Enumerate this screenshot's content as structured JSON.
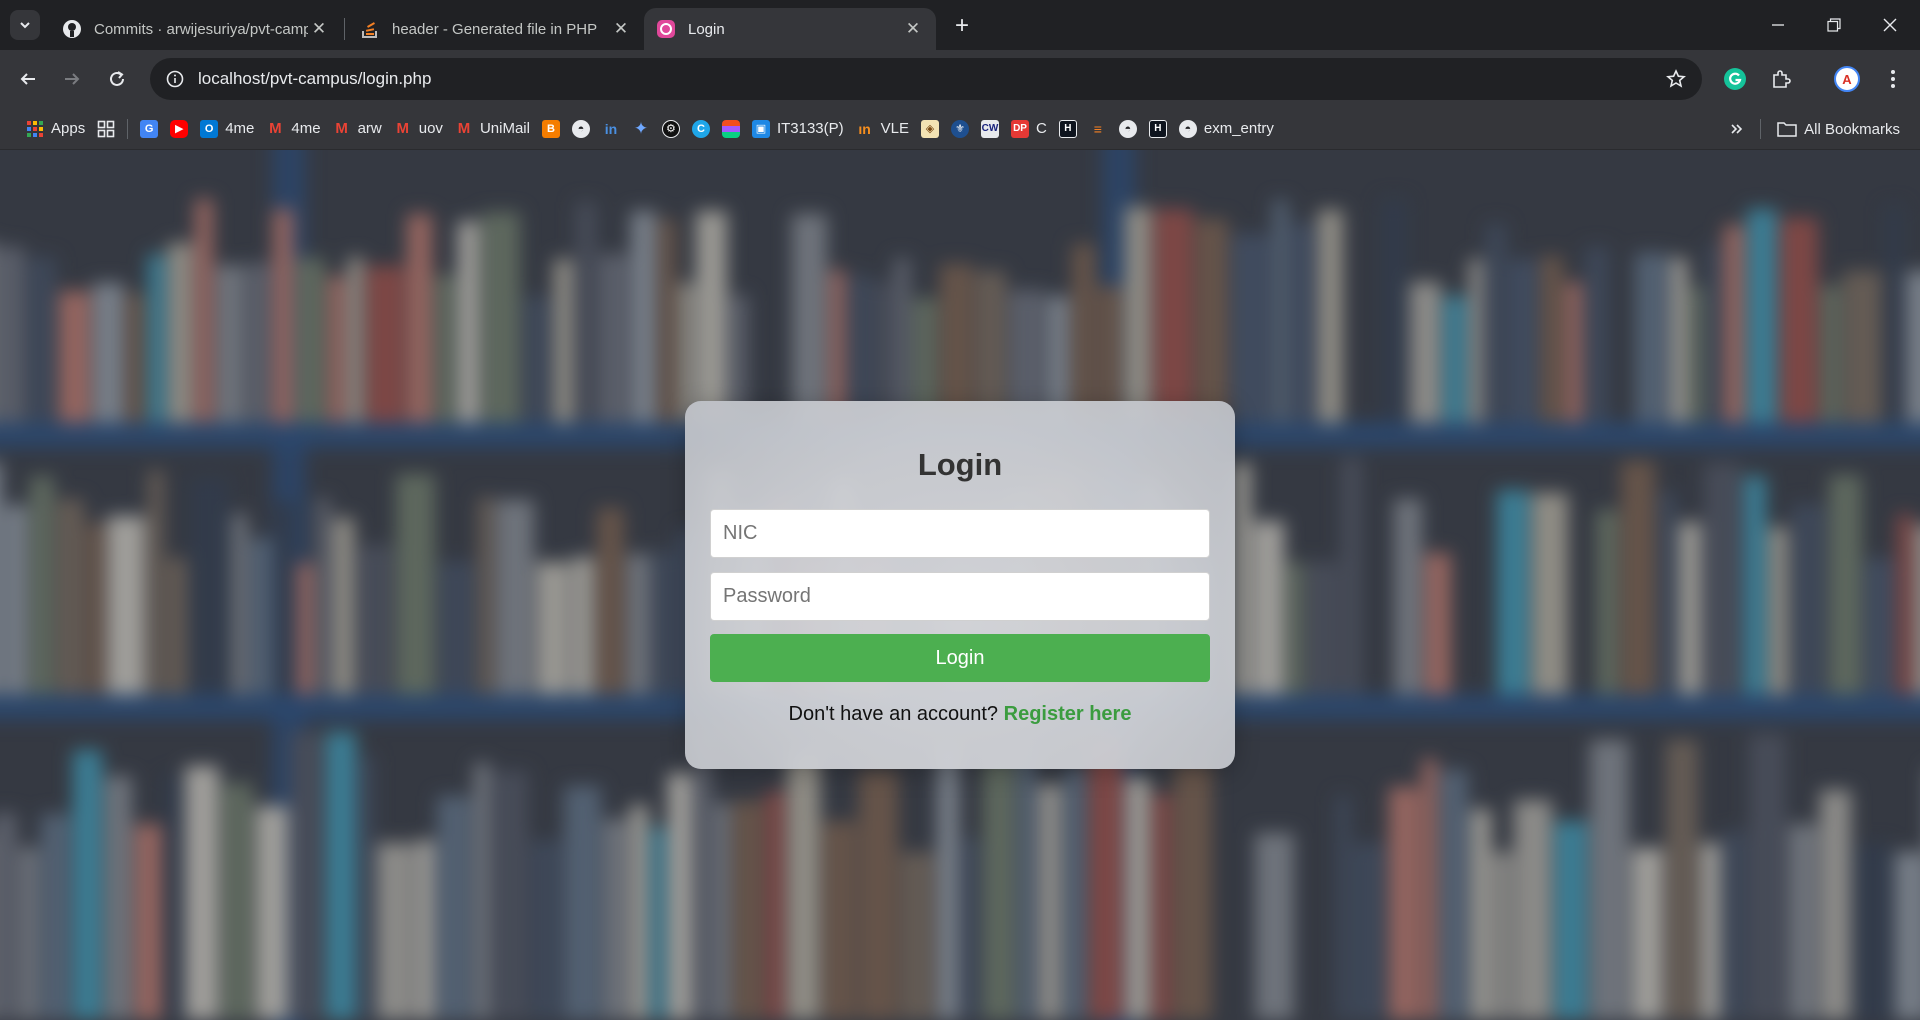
{
  "browser": {
    "tabs": [
      {
        "title": "Commits · arwijesuriya/pvt-campus",
        "icon": "github-icon"
      },
      {
        "title": "header - Generated file in PHP",
        "icon": "stackoverflow-icon"
      },
      {
        "title": "Login",
        "icon": "pink-app-icon",
        "active": true
      }
    ],
    "address_bar": {
      "url": "localhost/pvt-campus/login.php"
    },
    "bookmarks": [
      {
        "label": "Apps",
        "icon": "apps-grid-icon"
      },
      {
        "label": "",
        "icon": "grid-icon"
      },
      {
        "label": "",
        "icon": "google-translate-icon"
      },
      {
        "label": "",
        "icon": "youtube-icon"
      },
      {
        "label": "4me",
        "icon": "outlook-icon"
      },
      {
        "label": "4me",
        "icon": "gmail-icon"
      },
      {
        "label": "arw",
        "icon": "gmail-icon"
      },
      {
        "label": "uov",
        "icon": "gmail-icon"
      },
      {
        "label": "UniMail",
        "icon": "gmail-icon"
      },
      {
        "label": "",
        "icon": "blogger-icon"
      },
      {
        "label": "",
        "icon": "github-icon"
      },
      {
        "label": "",
        "icon": "linkedin-icon"
      },
      {
        "label": "",
        "icon": "gemini-icon"
      },
      {
        "label": "",
        "icon": "chatgpt-icon"
      },
      {
        "label": "",
        "icon": "canva-icon"
      },
      {
        "label": "",
        "icon": "figma-icon"
      },
      {
        "label": "IT3133(P)",
        "icon": "classroom-icon"
      },
      {
        "label": "VLE",
        "icon": "vle-icon"
      },
      {
        "label": "",
        "icon": "crest-icon"
      },
      {
        "label": "",
        "icon": "crest2-icon"
      },
      {
        "label": "",
        "icon": "cw-icon"
      },
      {
        "label": "C",
        "icon": "dp-icon"
      },
      {
        "label": "",
        "icon": "hackerrank-icon"
      },
      {
        "label": "",
        "icon": "stackoverflow-icon"
      },
      {
        "label": "",
        "icon": "github-icon"
      },
      {
        "label": "",
        "icon": "hackerrank-icon"
      },
      {
        "label": "exm_entry",
        "icon": "github-icon"
      }
    ],
    "all_bookmarks_label": "All Bookmarks"
  },
  "login": {
    "title": "Login",
    "nic_placeholder": "NIC",
    "password_placeholder": "Password",
    "button_label": "Login",
    "register_prompt": "Don't have an account?",
    "register_link": "Register here"
  },
  "colors": {
    "button": "#4caf50",
    "link": "#3b9c3f",
    "chrome_dark": "#202124",
    "chrome_toolbar": "#35363a"
  }
}
